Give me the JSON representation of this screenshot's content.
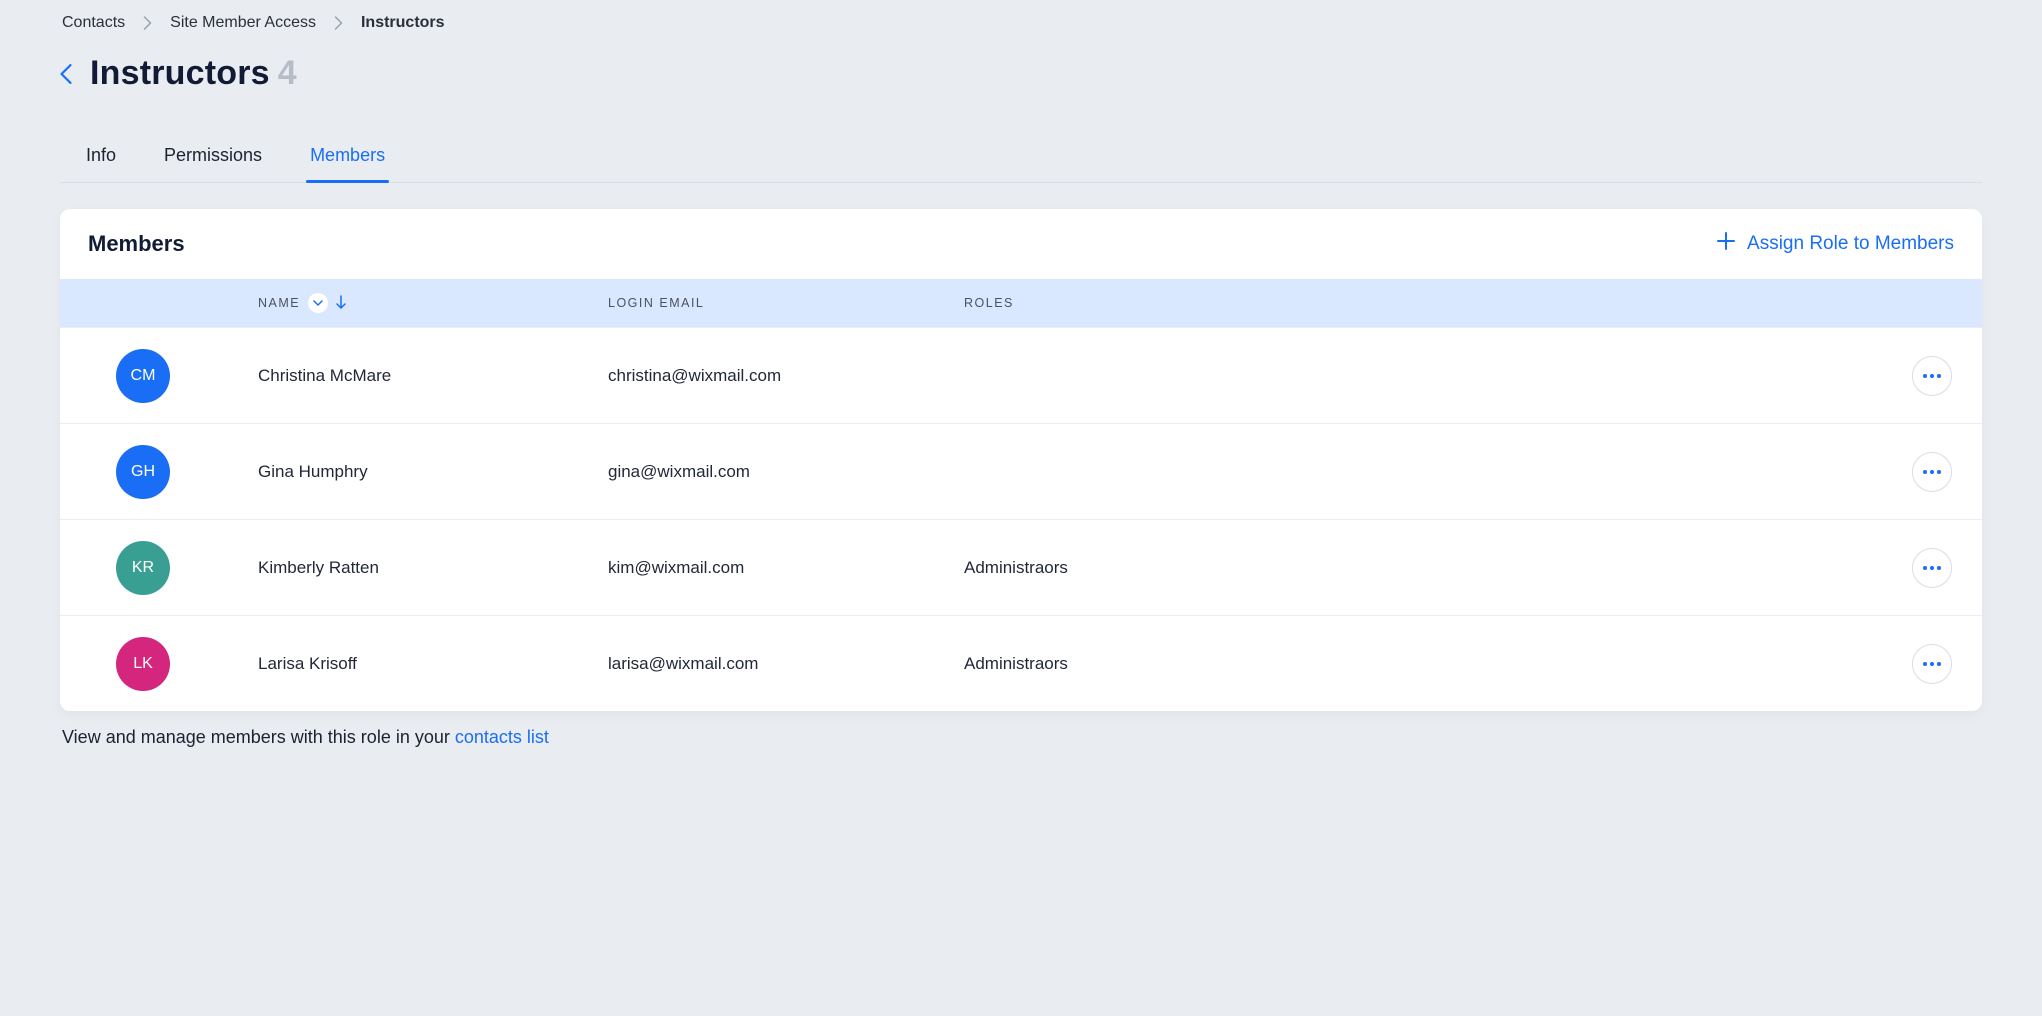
{
  "breadcrumb": {
    "items": [
      "Contacts",
      "Site Member Access",
      "Instructors"
    ],
    "current_index": 2
  },
  "title": {
    "text": "Instructors",
    "count": "4"
  },
  "tabs": {
    "items": [
      "Info",
      "Permissions",
      "Members"
    ],
    "active_index": 2
  },
  "card": {
    "title": "Members",
    "assign_label": "Assign Role to Members"
  },
  "table": {
    "columns": {
      "name": "NAME",
      "email": "LOGIN EMAIL",
      "roles": "ROLES"
    },
    "rows": [
      {
        "initials": "CM",
        "name": "Christina McMare",
        "email": "christina@wixmail.com",
        "roles": "",
        "avatar_color": "#1a6ef5"
      },
      {
        "initials": "GH",
        "name": "Gina Humphry",
        "email": "gina@wixmail.com",
        "roles": "",
        "avatar_color": "#1a6ef5"
      },
      {
        "initials": "KR",
        "name": "Kimberly Ratten",
        "email": "kim@wixmail.com",
        "roles": "Administraors",
        "avatar_color": "#3a9f93"
      },
      {
        "initials": "LK",
        "name": "Larisa Krisoff",
        "email": "larisa@wixmail.com",
        "roles": "Administraors",
        "avatar_color": "#d5267d"
      }
    ]
  },
  "footer": {
    "text": "View and manage members with this role in your  ",
    "link": "contacts list"
  }
}
